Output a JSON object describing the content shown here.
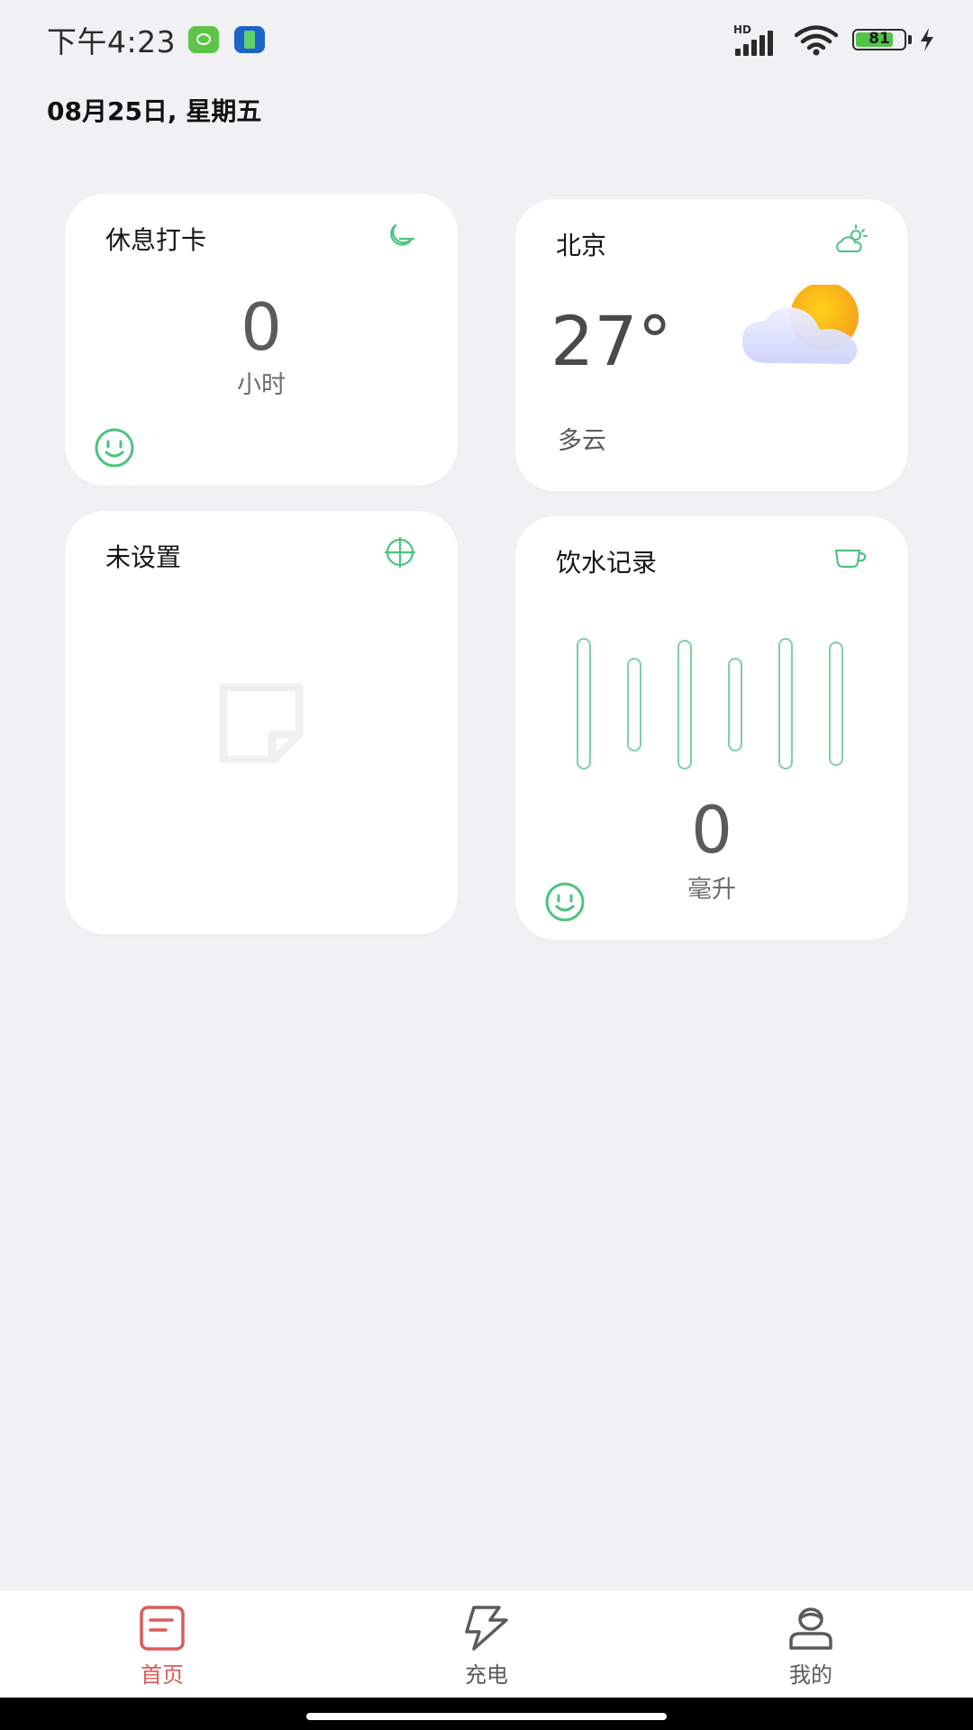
{
  "status_bar": {
    "time": "下午4:23",
    "network": "HD",
    "battery": "81",
    "battery_level": 0.81
  },
  "date": "08月25日, 星期五",
  "cards": {
    "rest": {
      "title": "休息打卡",
      "value": "0",
      "unit": "小时",
      "icon": "moon-icon",
      "status_icon": "smile-icon"
    },
    "weather": {
      "title": "北京",
      "temperature": "27°",
      "condition": "多云",
      "icon": "sun-cloud-icon",
      "illustration": "partly-cloudy-illustration"
    },
    "unset": {
      "title": "未设置",
      "icon": "crosshair-icon",
      "placeholder_icon": "note-placeholder-icon"
    },
    "water": {
      "title": "饮水记录",
      "value": "0",
      "unit": "毫升",
      "icon": "cup-icon",
      "status_icon": "smile-icon"
    }
  },
  "nav": {
    "home": "首页",
    "charge": "充电",
    "mine": "我的",
    "active": "home"
  },
  "colors": {
    "accent_green": "#4cc37f",
    "active_red": "#d95c5c",
    "background": "#f1f0f3"
  }
}
